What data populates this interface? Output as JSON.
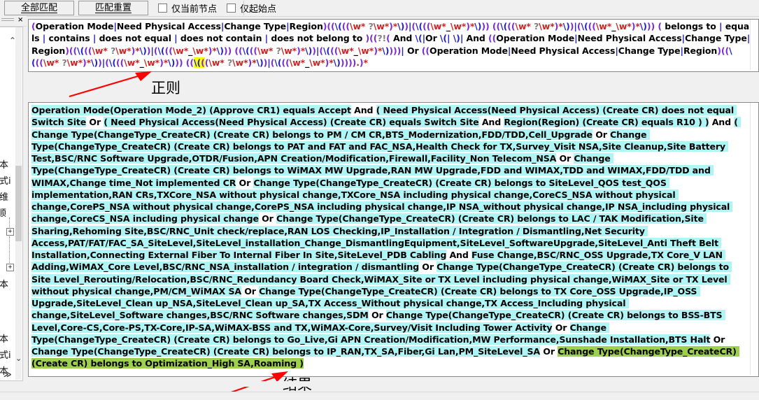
{
  "toolbar": {
    "match_all_label": "全部匹配",
    "match_reset_label": "匹配重置",
    "checkbox_current_node_label": "仅当前节点",
    "checkbox_start_node_label": "仅起始点",
    "checkbox_current_node_checked": false,
    "checkbox_start_node_checked": false
  },
  "dock": {
    "close_label": "×",
    "scroll_up_label": "⌃",
    "scroll_down_label": "⌄",
    "expand_label": "≫",
    "items": [
      {
        "label": "文本",
        "expand": false
      },
      {
        "label": "達式i",
        "expand": false
      },
      {
        "label": "获维",
        "expand": false
      },
      {
        "label": "顺",
        "expand": false
      },
      {
        "label": "",
        "expand": true
      },
      {
        "label": "",
        "expand": true
      },
      {
        "label": "文本",
        "expand": false
      },
      {
        "label": "文本",
        "expand": false
      },
      {
        "label": "達式i",
        "expand": false
      },
      {
        "label": "文本",
        "expand": false
      }
    ]
  },
  "regex_pane": {
    "title": "正则",
    "text": "(Operation Mode|Need Physical Access|Change Type|Region)((\\(((\\w* ?\\w*)*\\))|(\\(((\\w*_\\w*)*\\))) ((\\(((\\w* ?\\w*)*\\))|(\\(((\\w*_\\w*)*\\))) ( belongs to | equals | contains | does not equal | does not contain | does not belong to )((?!( And \\(|Or \\(| \\)| And ((Operation Mode|Need Physical Access|Change Type|Region)((\\(((\\w* ?\\w*)*\\))|(\\(((\\w*_\\w*)*\\))) ((\\(((\\w* ?\\w*)*\\))|(\\(((\\w*_\\w*)*\\))))| Or ((Operation Mode|Need Physical Access|Change Type|Region)((\\(((\\w* ?\\w*)*\\))|(\\(((\\w*_\\w*)*\\))) ((\\(((\\w* ?\\w*)*\\))|(\\(((\\w*_\\w*)*\\))))).)*",
    "highlight_token": "\\("
  },
  "result_pane": {
    "title": "结果",
    "text": "Operation Mode(Operation Mode_2) (Approve CR1) equals Accept And ( Need Physical Access(Need Physical Access) (Create CR) does not equal Switch Site Or ( Need Physical Access(Need Physical Access) (Create CR) equals Switch Site And Region(Region) (Create CR) equals R10 ) ) And ( Change Type(ChangeType_CreateCR) (Create CR) belongs to PM / CM CR,BTS_Modernization,FDD/TDD,Cell_Upgrade Or Change Type(ChangeType_CreateCR) (Create CR) belongs to PAT and FAT and FAC_NSA,Health Check for TX,Survey_Visit NSA,Site Cleanup,Site Battery Test,BSC/RNC Software Upgrade,OTDR/Fusion,APN Creation/Modification,Firewall,Facility_Non Telecom_NSA Or Change Type(ChangeType_CreateCR) (Create CR) belongs to WiMAX MW Upgrade,RAN MW Upgrade,FDD and WIMAX,TDD and WIMAX,FDD/TDD and WIMAX,Change time_Not implemented CR Or Change Type(ChangeType_CreateCR) (Create CR) belongs to SiteLevel_QOS test_QOS implementation,RAN CRs,TXCore_NSA without physical change,TXCore_NSA including physical change,CoreCS_NSA without physical change,CorePS_NSA without physical change,CorePS_NSA including physical change,IP NSA_without physical change,IP NSA_including physical change,CoreCS_NSA including physical change Or Change Type(ChangeType_CreateCR) (Create CR) belongs to LAC / TAK Modification,Site Sharing,Rehoming Site,BSC/RNC_Unit check/replace,RAN LOS Checking,IP_Installation / Integration / Dismantling,Net Security Access,PAT/FAT/FAC_SA_SiteLevel,SiteLevel_installation_Change_DismantlingEquipment,SiteLevel_SoftwareUpgrade,SiteLevel_Anti Theft Belt Installation,Connecting External Fiber To Internal Fiber In Site,SiteLevel_PDB Cabling And Fuse Change,BSC/RNC_OSS Upgrade,TX Core_V LAN Adding,WiMAX_Core Level,BSC/RNC_NSA_installation / integration / dismantling Or Change Type(ChangeType_CreateCR) (Create CR) belongs to Site Level_Rerouting/Relocation,BSC/RNC_Redundancy Board Check,WiMAX_Site or TX Level including physical change,WiMAX_Site or TX Level without physical change,PM/CM_WiMAX SA Or Change Type(ChangeType_CreateCR) (Create CR) belongs to TX Core_OSS Upgrade,IP_OSS Upgrade,SiteLevel_Clean up_NSA,SiteLevel_Clean up_SA,TX Access_Without physical change,TX Access_Including physical change,SiteLevel_Software changes,BSC/RNC Software changes,SDM Or Change Type(ChangeType_CreateCR) (Create CR) belongs to BSS-BTS Level,Core-CS,Core-PS,TX-Core,IP-SA,WiMAX-BSS and TX,WiMAX-Core,Survey/Visit Including Tower Activity Or Change Type(ChangeType_CreateCR) (Create CR) belongs to Go_Live,Gi APN Creation/Modification,MW Performance,Sunshade Installation,BTS Halt Or Change Type(ChangeType_CreateCR) (Create CR) belongs to IP_RAN,TX_SA,Fiber,Gi Lan,PM_SiteLevel_SA Or Change Type(ChangeType_CreateCR) (Create CR) belongs to Optimization_High SA,Roaming )"
  },
  "colors": {
    "match_highlight_cyan": "#b0f5f5",
    "match_highlight_green": "#9ed04f",
    "regex_highlight_yellow": "#ffff00",
    "annotation_arrow_red": "#ff0000",
    "regex_token_purple": "#7a2ad6",
    "regex_token_blue": "#2222cc",
    "regex_token_red": "#cc2222",
    "regex_token_orange": "#c0531a"
  }
}
